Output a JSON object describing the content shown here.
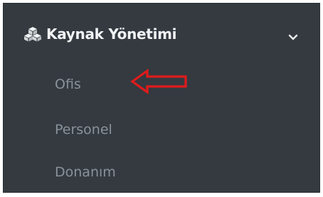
{
  "menu": {
    "header_label": "Kaynak Yönetimi",
    "header_icon": "cubes-icon",
    "toggle_icon": "chevron-down-icon",
    "items": [
      {
        "label": "Ofis"
      },
      {
        "label": "Personel"
      },
      {
        "label": "Donanım"
      }
    ]
  },
  "annotation": {
    "icon": "arrow-left-icon",
    "color": "#e01b1b"
  },
  "colors": {
    "panel_bg": "#343a40",
    "header_text": "#f1f3f5",
    "item_text": "#8a9299"
  }
}
